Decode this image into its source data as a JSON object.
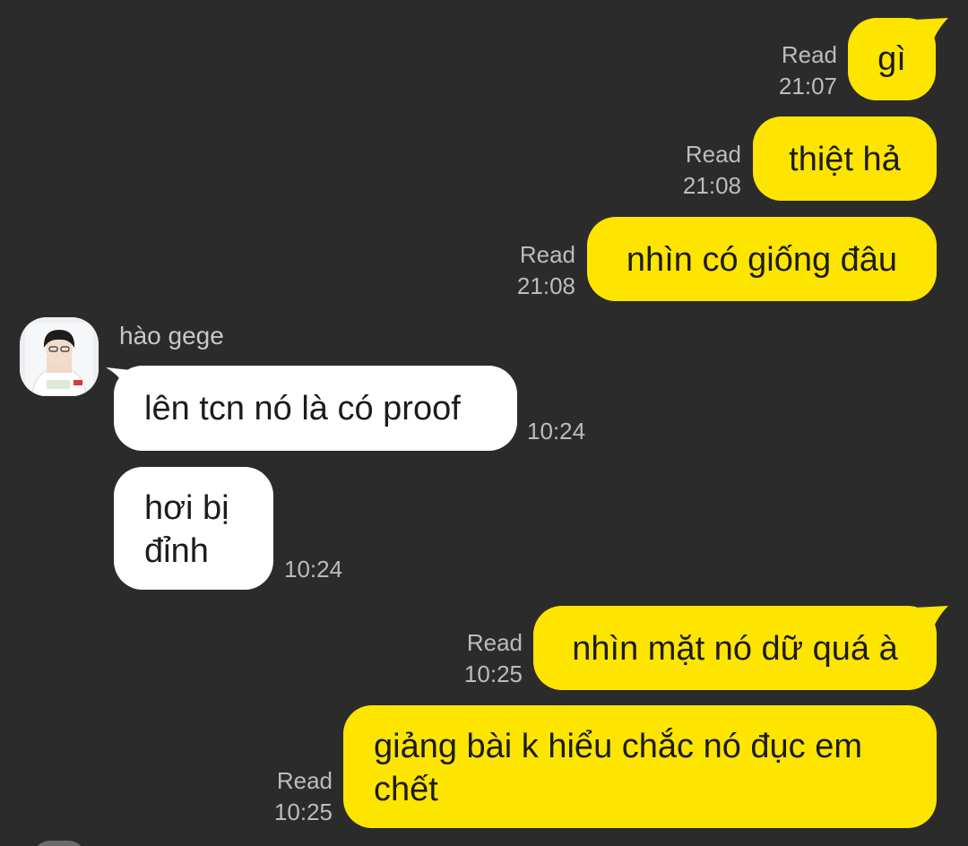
{
  "contact": {
    "name": "hào gege"
  },
  "messages": [
    {
      "from": "me",
      "text": "gì",
      "status": "Read",
      "time": "21:07"
    },
    {
      "from": "me",
      "text": "thiệt hả",
      "status": "Read",
      "time": "21:08"
    },
    {
      "from": "me",
      "text": "nhìn có giống đâu",
      "status": "Read",
      "time": "21:08"
    },
    {
      "from": "contact",
      "text": "lên tcn nó là có proof",
      "time": "10:24"
    },
    {
      "from": "contact",
      "text": "hơi bị đỉnh",
      "time": "10:24"
    },
    {
      "from": "me",
      "text": "nhìn mặt nó dữ quá à",
      "status": "Read",
      "time": "10:25"
    },
    {
      "from": "me",
      "text": "giảng bài k hiểu chắc nó đục em chết",
      "status": "Read",
      "time": "10:25"
    }
  ],
  "colors": {
    "background": "#2b2b2b",
    "outgoing_bubble": "#fee500",
    "incoming_bubble": "#ffffff",
    "meta_text": "#bcbcbc"
  }
}
